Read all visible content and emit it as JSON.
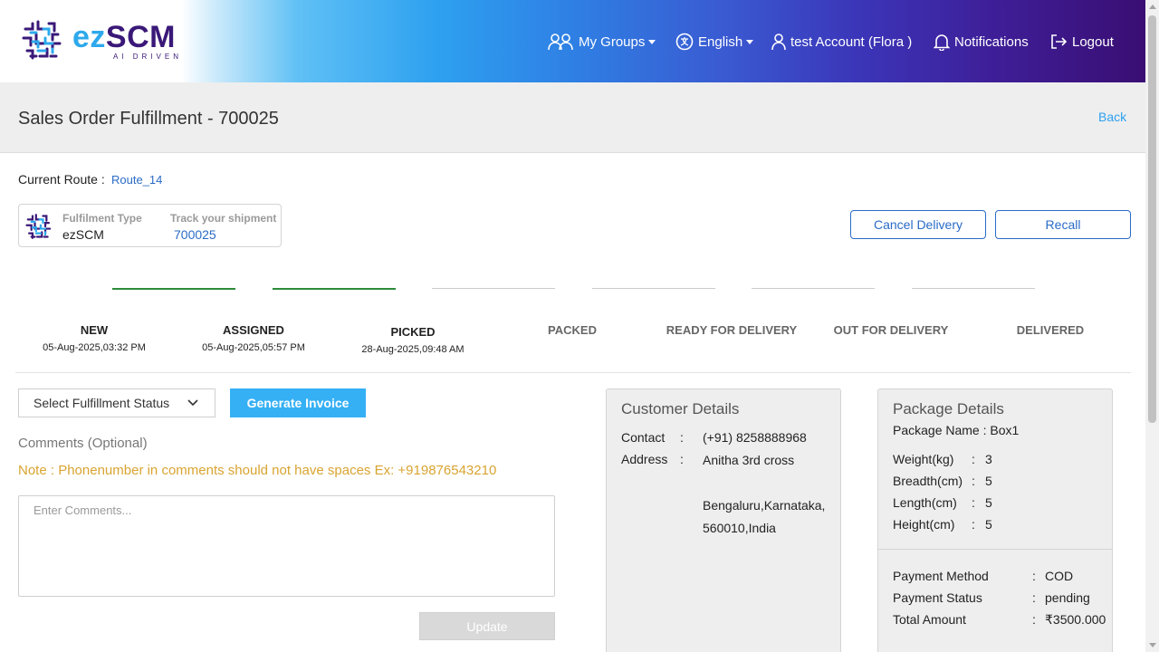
{
  "header": {
    "logo_ez": "ez",
    "logo_scm": "SCM",
    "logo_tagline": "AI DRIVEN",
    "nav": {
      "groups": "My Groups",
      "language": "English",
      "account": "test Account (Flora )",
      "notifications": "Notifications",
      "logout": "Logout"
    }
  },
  "page": {
    "title": "Sales Order Fulfillment - 700025",
    "back": "Back"
  },
  "route": {
    "label": "Current Route :",
    "value": "Route_14"
  },
  "fulfillment_card": {
    "type_label": "Fulfilment Type",
    "type_value": "ezSCM",
    "track_label": "Track your shipment",
    "track_value": "700025"
  },
  "actions": {
    "cancel": "Cancel Delivery",
    "recall": "Recall"
  },
  "steps": [
    {
      "name": "NEW",
      "date": "05-Aug-2025,03:32 PM",
      "done": true
    },
    {
      "name": "ASSIGNED",
      "date": "05-Aug-2025,05:57 PM",
      "done": true
    },
    {
      "name": "PICKED",
      "date": "28-Aug-2025,09:48 AM",
      "done": true
    },
    {
      "name": "PACKED",
      "date": "",
      "done": false
    },
    {
      "name": "READY FOR DELIVERY",
      "date": "",
      "done": false
    },
    {
      "name": "OUT FOR DELIVERY",
      "date": "",
      "done": false
    },
    {
      "name": "DELIVERED",
      "date": "",
      "done": false
    }
  ],
  "form": {
    "status_select": "Select Fulfillment Status",
    "generate_invoice": "Generate Invoice",
    "comments_label": "Comments",
    "comments_optional": "(Optional)",
    "note_label": "Note :",
    "note_text": "Phonenumber in comments should not have spaces Ex: +919876543210",
    "comment_placeholder": "Enter Comments...",
    "update": "Update"
  },
  "customer": {
    "title": "Customer Details",
    "contact_label": "Contact",
    "contact_value": "(+91) 8258888968",
    "address_label": "Address",
    "address_line1": "Anitha 3rd cross",
    "address_line2": "Bengaluru,Karnataka,",
    "address_line3": "560010,India",
    "sep": ":"
  },
  "package": {
    "title": "Package Details",
    "name": "Package Name : Box1",
    "rows": [
      {
        "label": "Weight(kg)",
        "value": "3"
      },
      {
        "label": "Breadth(cm)",
        "value": "5"
      },
      {
        "label": "Length(cm)",
        "value": "5"
      },
      {
        "label": "Height(cm)",
        "value": "5"
      }
    ],
    "payment": [
      {
        "label": "Payment Method",
        "value": "COD"
      },
      {
        "label": "Payment Status",
        "value": "pending"
      },
      {
        "label": "Total Amount",
        "value": "₹3500.000"
      }
    ],
    "sep": ":"
  },
  "colors": {
    "accent": "#2ea1f0",
    "link": "#2a6bc7",
    "brand_dark": "#3a1878",
    "step_done": "#2e8b3a",
    "note": "#d9a431"
  }
}
